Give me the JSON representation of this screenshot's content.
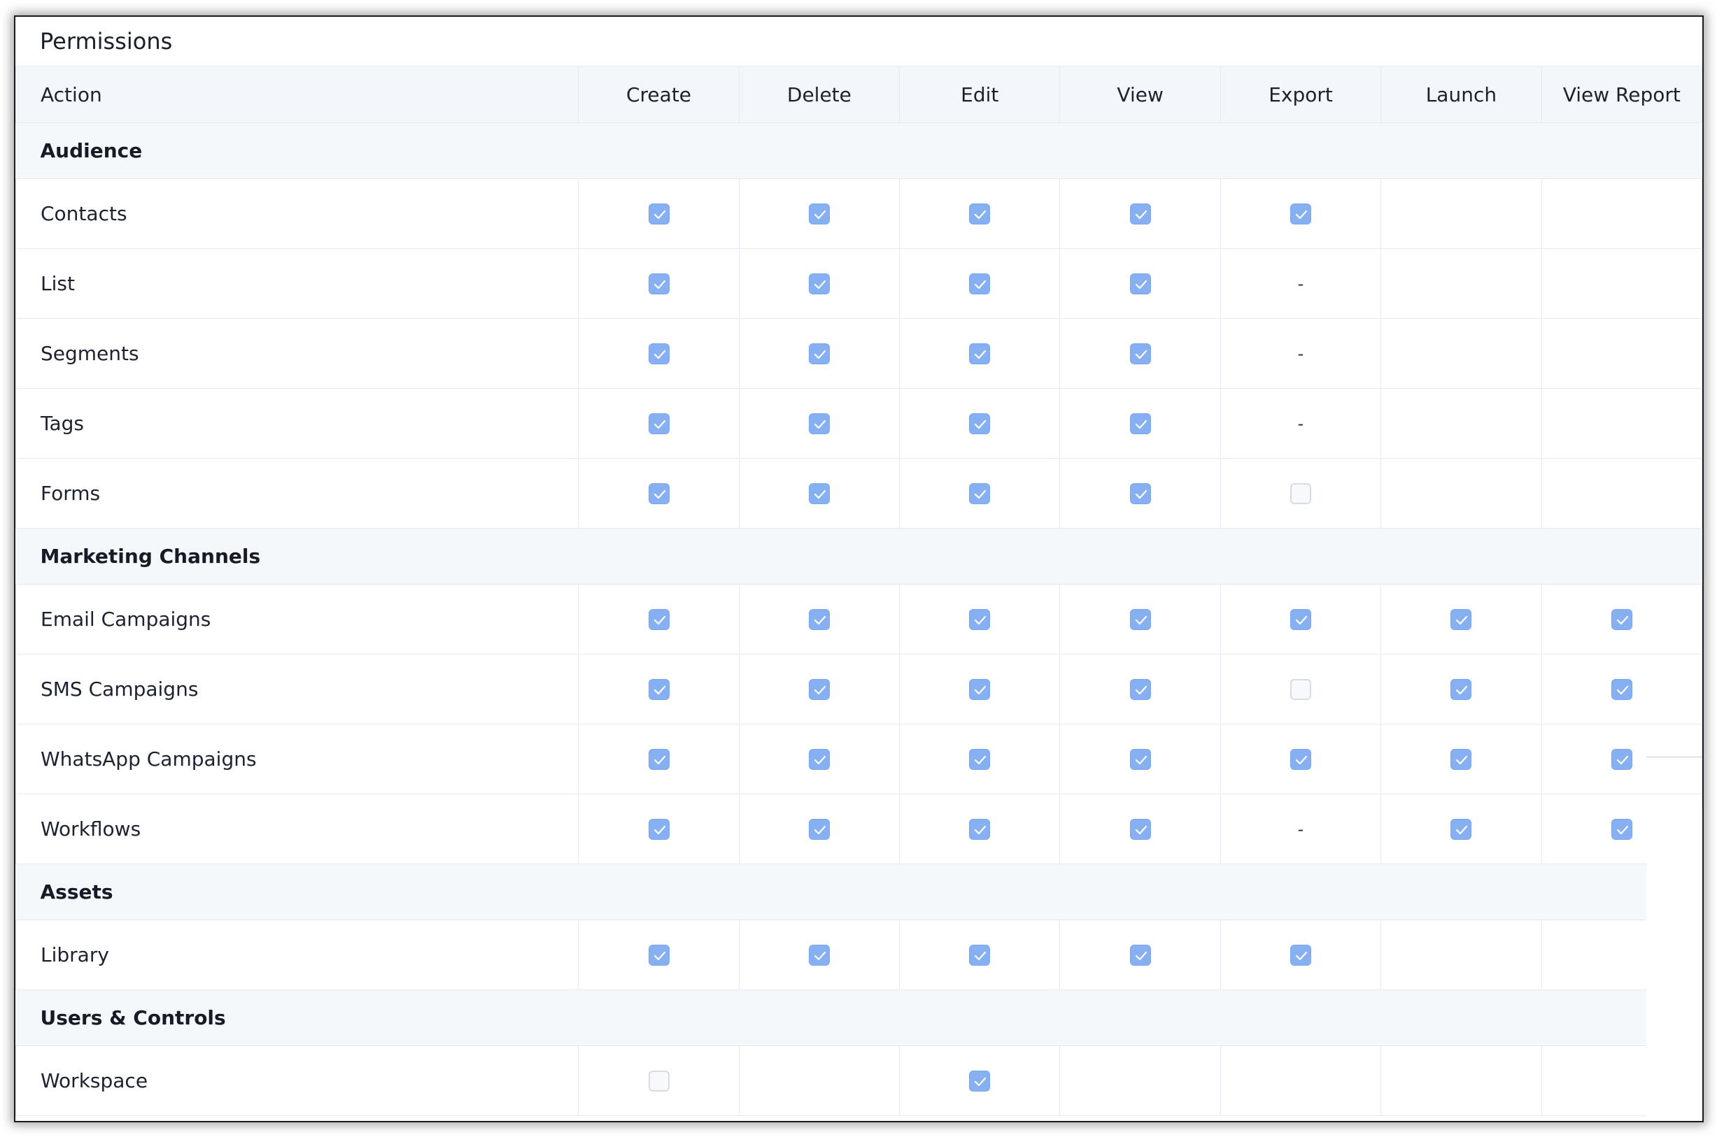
{
  "panel": {
    "title": "Permissions"
  },
  "table": {
    "action_header": "Action",
    "columns": [
      "Create",
      "Delete",
      "Edit",
      "View",
      "Export",
      "Launch",
      "View Report"
    ],
    "sections": [
      {
        "name": "Audience",
        "rows": [
          {
            "label": "Contacts",
            "cells": [
              "checked",
              "checked",
              "checked",
              "checked",
              "checked",
              "none",
              "none"
            ]
          },
          {
            "label": "List",
            "cells": [
              "checked",
              "checked",
              "checked",
              "checked",
              "dash",
              "none",
              "none"
            ]
          },
          {
            "label": "Segments",
            "cells": [
              "checked",
              "checked",
              "checked",
              "checked",
              "dash",
              "none",
              "none"
            ]
          },
          {
            "label": "Tags",
            "cells": [
              "checked",
              "checked",
              "checked",
              "checked",
              "dash",
              "none",
              "none"
            ]
          },
          {
            "label": "Forms",
            "cells": [
              "checked",
              "checked",
              "checked",
              "checked",
              "unchecked",
              "none",
              "none"
            ]
          }
        ]
      },
      {
        "name": "Marketing Channels",
        "rows": [
          {
            "label": "Email Campaigns",
            "cells": [
              "checked",
              "checked",
              "checked",
              "checked",
              "checked",
              "checked",
              "checked"
            ]
          },
          {
            "label": "SMS Campaigns",
            "cells": [
              "checked",
              "checked",
              "checked",
              "checked",
              "unchecked",
              "checked",
              "checked"
            ]
          },
          {
            "label": "WhatsApp Campaigns",
            "cells": [
              "checked",
              "checked",
              "checked",
              "checked",
              "checked",
              "checked",
              "checked"
            ]
          },
          {
            "label": "Workflows",
            "cells": [
              "checked",
              "checked",
              "checked",
              "checked",
              "dash",
              "checked",
              "checked"
            ]
          }
        ]
      },
      {
        "name": "Assets",
        "rows": [
          {
            "label": "Library",
            "cells": [
              "checked",
              "checked",
              "checked",
              "checked",
              "checked",
              "none",
              "none"
            ]
          }
        ]
      },
      {
        "name": "Users & Controls",
        "rows": [
          {
            "label": "Workspace",
            "cells": [
              "unchecked",
              "none",
              "checked",
              "none",
              "none",
              "none",
              "none"
            ]
          }
        ]
      }
    ],
    "dash_text": "-"
  },
  "colors": {
    "checkbox_fill": "#86b0f2",
    "header_bg": "#f3f6fa",
    "section_bg": "#f5f8fb",
    "grid": "#e6eaf0"
  },
  "icons": {
    "checked": "checkmark-icon",
    "unchecked": "empty-checkbox"
  }
}
